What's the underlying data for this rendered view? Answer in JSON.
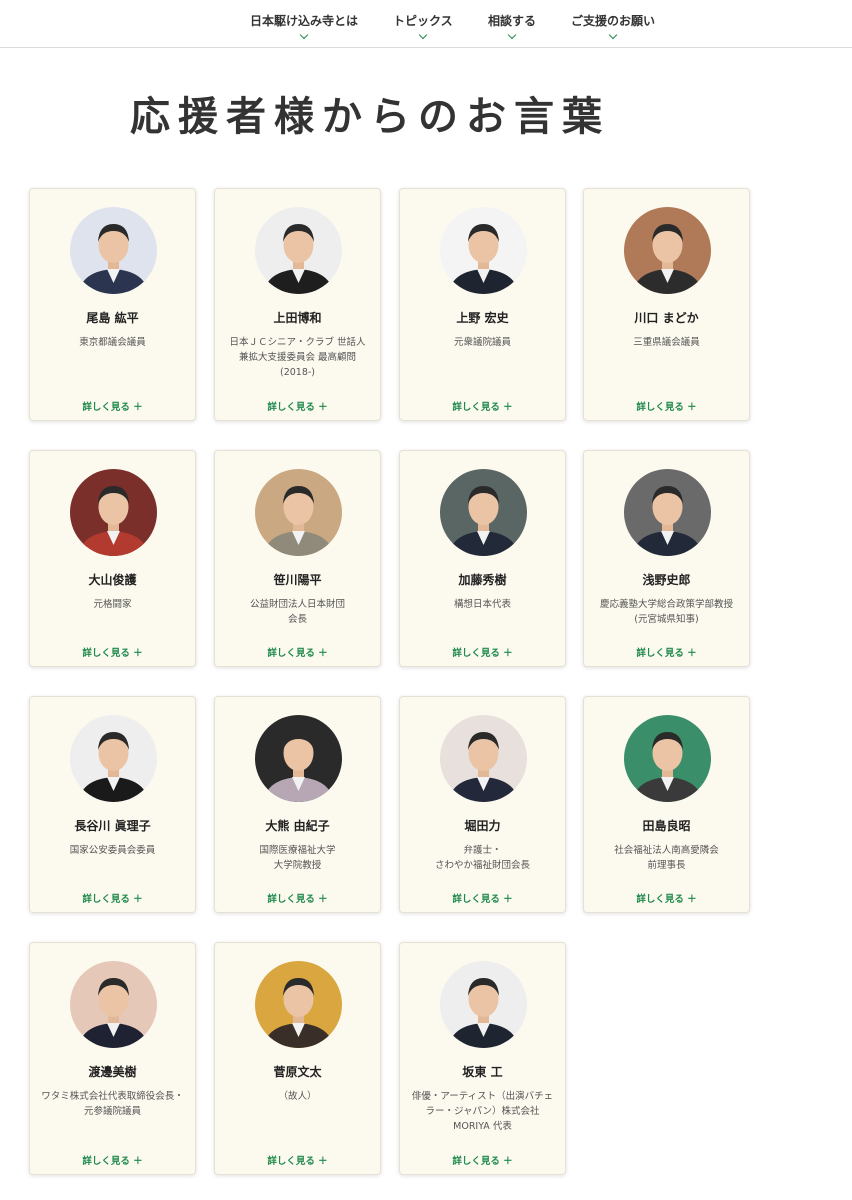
{
  "nav": {
    "items": [
      "日本駆け込み寺とは",
      "トピックス",
      "相談する",
      "ご支援のお願い"
    ]
  },
  "page": {
    "title": "応援者様からのお言葉"
  },
  "more_label": "詳しく見る ＋",
  "colors": {
    "accent": "#1f8a4c",
    "card_bg": "#fcf9ef"
  },
  "cards": [
    {
      "name": "尾島 紘平",
      "role": "東京都議会議員"
    },
    {
      "name": "上田博和",
      "role": "日本ＪＣシニア・クラブ 世話人兼拡大支援委員会 最高顧問(2018-)"
    },
    {
      "name": "上野 宏史",
      "role": "元衆議院議員"
    },
    {
      "name": "川口 まどか",
      "role": "三重県議会議員"
    },
    {
      "name": "大山俊護",
      "role": "元格闘家"
    },
    {
      "name": "笹川陽平",
      "role": "公益財団法人日本財団\n会長"
    },
    {
      "name": "加藤秀樹",
      "role": "構想日本代表"
    },
    {
      "name": "浅野史郎",
      "role": "慶応義塾大学総合政策学部教授(元宮城県知事)"
    },
    {
      "name": "長谷川 眞理子",
      "role": "国家公安委員会委員"
    },
    {
      "name": "大熊 由紀子",
      "role": "国際医療福祉大学\n大学院教授"
    },
    {
      "name": "堀田力",
      "role": "弁護士・\nさわやか福祉財団会長"
    },
    {
      "name": "田島良昭",
      "role": "社会福祉法人南高愛隣会\n前理事長"
    },
    {
      "name": "渡邊美樹",
      "role": "ワタミ株式会社代表取締役会長・元参議院議員"
    },
    {
      "name": "菅原文太",
      "role": "（故人）"
    },
    {
      "name": "坂東 工",
      "role": "俳優・アーティスト（出演バチェラー・ジャパン）株式会社MORIYA 代表"
    }
  ]
}
